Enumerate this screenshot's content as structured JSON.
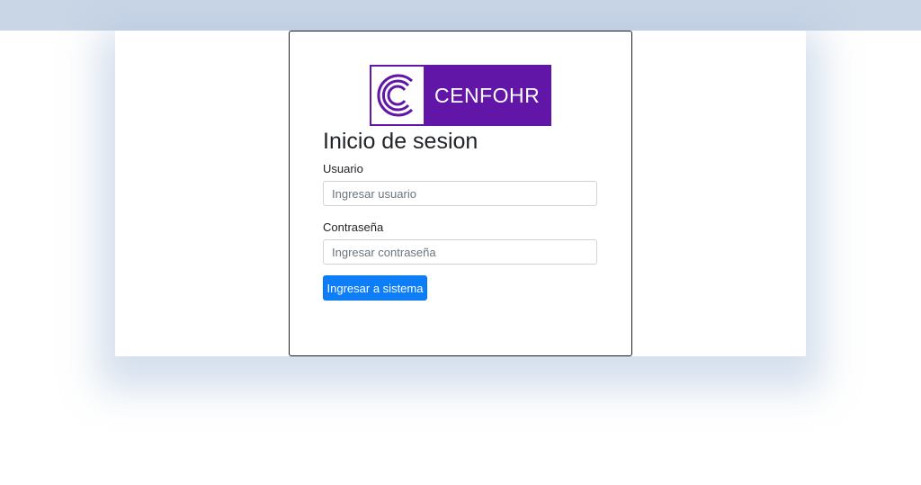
{
  "logo": {
    "text": "CENFOHR"
  },
  "login": {
    "title": "Inicio de sesion",
    "username": {
      "label": "Usuario",
      "placeholder": "Ingresar usuario"
    },
    "password": {
      "label": "Contraseña",
      "placeholder": "Ingresar contraseña"
    },
    "submit_label": "Ingresar a sistema"
  },
  "colors": {
    "brand_purple": "#6116a8",
    "primary_button": "#0d7ef8",
    "top_band": "#c9d6e6"
  }
}
